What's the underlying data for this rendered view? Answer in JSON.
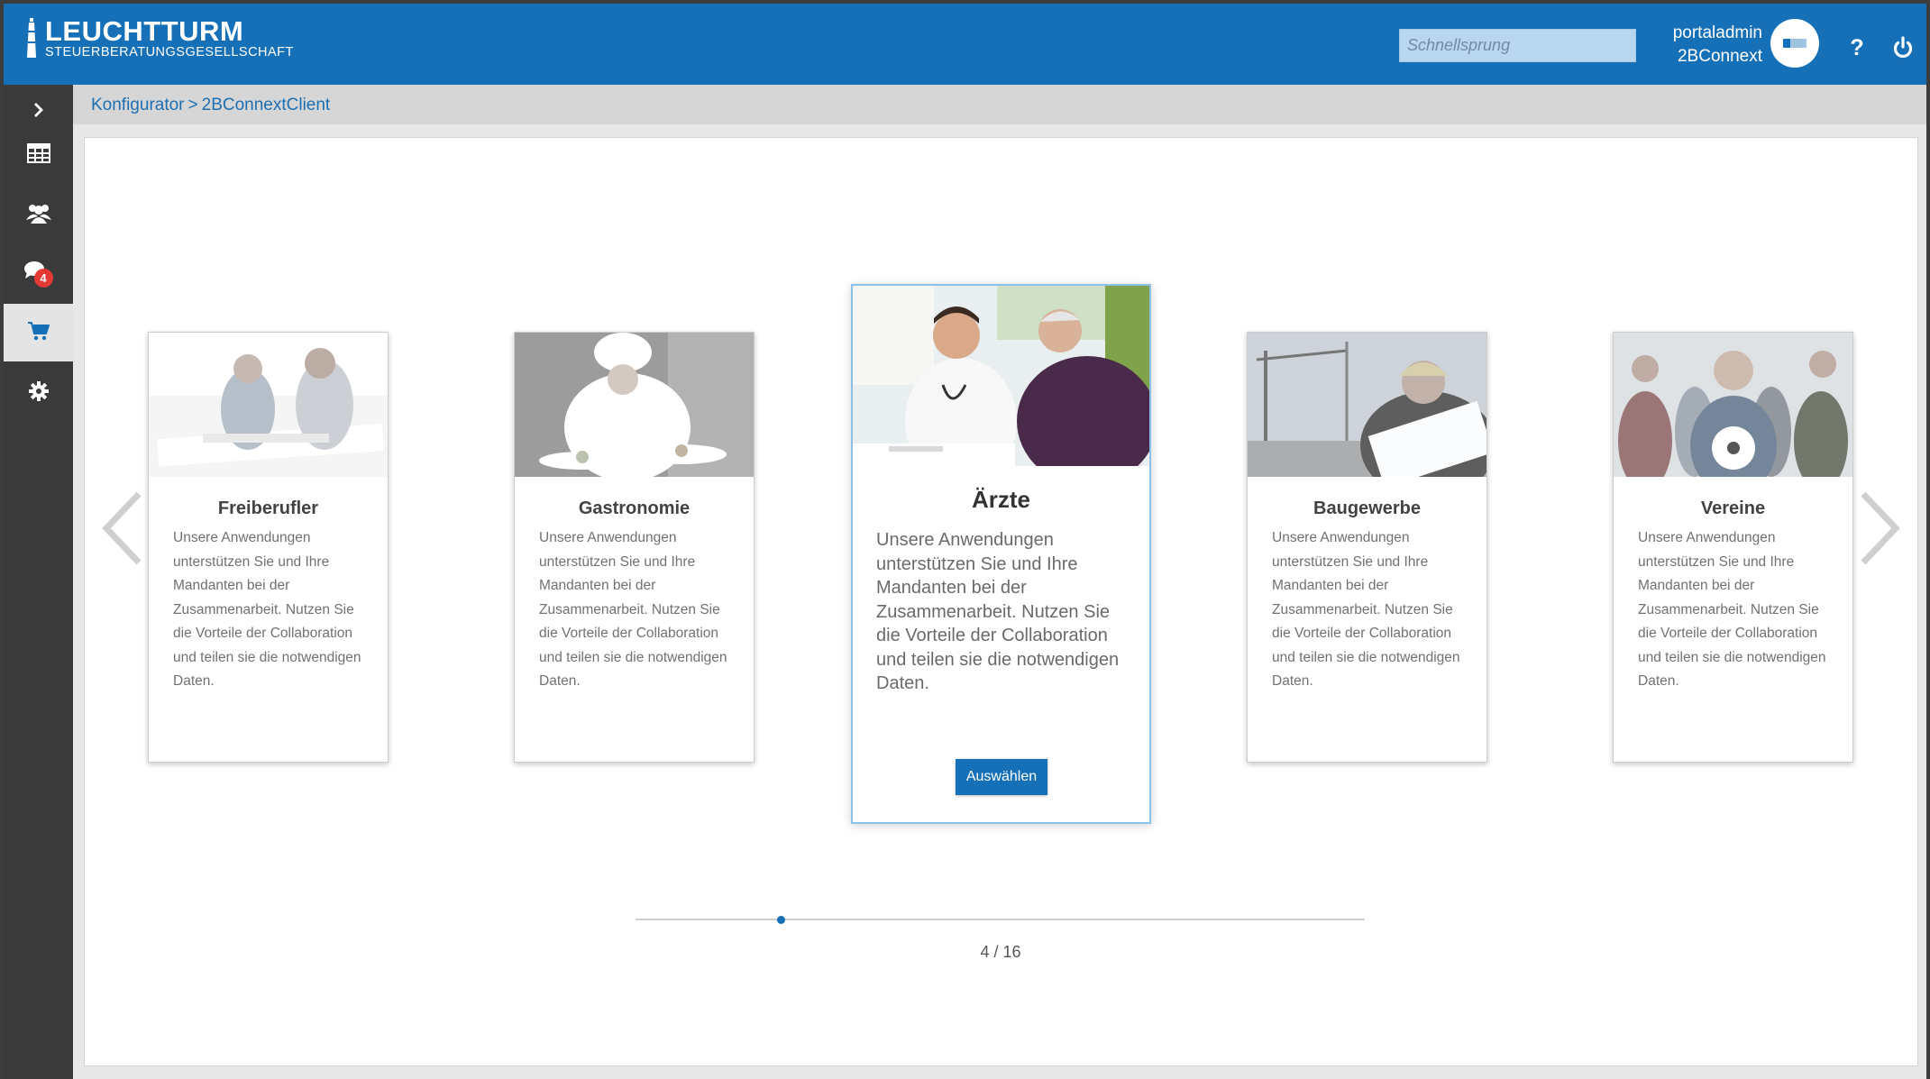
{
  "brand": {
    "title": "LEUCHTTURM",
    "subtitle": "STEUERBERATUNGSGESELLSCHAFT"
  },
  "search": {
    "placeholder": "Schnellsprung"
  },
  "user": {
    "name": "portaladmin",
    "org": "2BConnext"
  },
  "header_icons": {
    "help": "?",
    "power": "power-icon"
  },
  "sidebar": {
    "items": [
      {
        "icon": "chevron-right-icon"
      },
      {
        "icon": "table-icon"
      },
      {
        "icon": "users-icon"
      },
      {
        "icon": "chat-icon",
        "badge": "4"
      },
      {
        "icon": "cart-icon",
        "active": true
      },
      {
        "icon": "gear-icon"
      }
    ]
  },
  "breadcrumb": {
    "items": [
      "Konfigurator",
      "2BConnextClient"
    ],
    "separator": ">"
  },
  "cards": [
    {
      "title": "Freiberufler",
      "description": "Unsere Anwendungen unterstützen Sie und Ihre Mandanten bei der Zusammenarbeit. Nutzen Sie die Vorteile der Collaboration und teilen sie die notwendigen Daten."
    },
    {
      "title": "Gastronomie",
      "description": "Unsere Anwendungen unterstützen Sie und Ihre Mandanten bei der Zusammenarbeit. Nutzen Sie die Vorteile der Collaboration und teilen sie die notwendigen Daten."
    },
    {
      "title": "Ärzte",
      "description": "Unsere Anwendungen unterstützen Sie und Ihre Mandanten bei der Zusammenarbeit. Nutzen Sie die Vorteile der Collaboration und teilen sie die notwendigen Daten.",
      "button": "Auswählen"
    },
    {
      "title": "Baugewerbe",
      "description": "Unsere Anwendungen unterstützen Sie und Ihre Mandanten bei der Zusammenarbeit. Nutzen Sie die Vorteile der Collaboration und teilen sie die notwendigen Daten."
    },
    {
      "title": "Vereine",
      "description": "Unsere Anwendungen unterstützen Sie und Ihre Mandanten bei der Zusammenarbeit. Nutzen Sie die Vorteile der Collaboration und teilen sie die notwendigen Daten."
    }
  ],
  "pager": {
    "current": 4,
    "total": 16,
    "label": "4 / 16",
    "progress": 0.2
  },
  "colors": {
    "brand": "#1570b8",
    "sidebar": "#3a3a3a",
    "badge": "#e53935",
    "link": "#1d6fb3"
  }
}
